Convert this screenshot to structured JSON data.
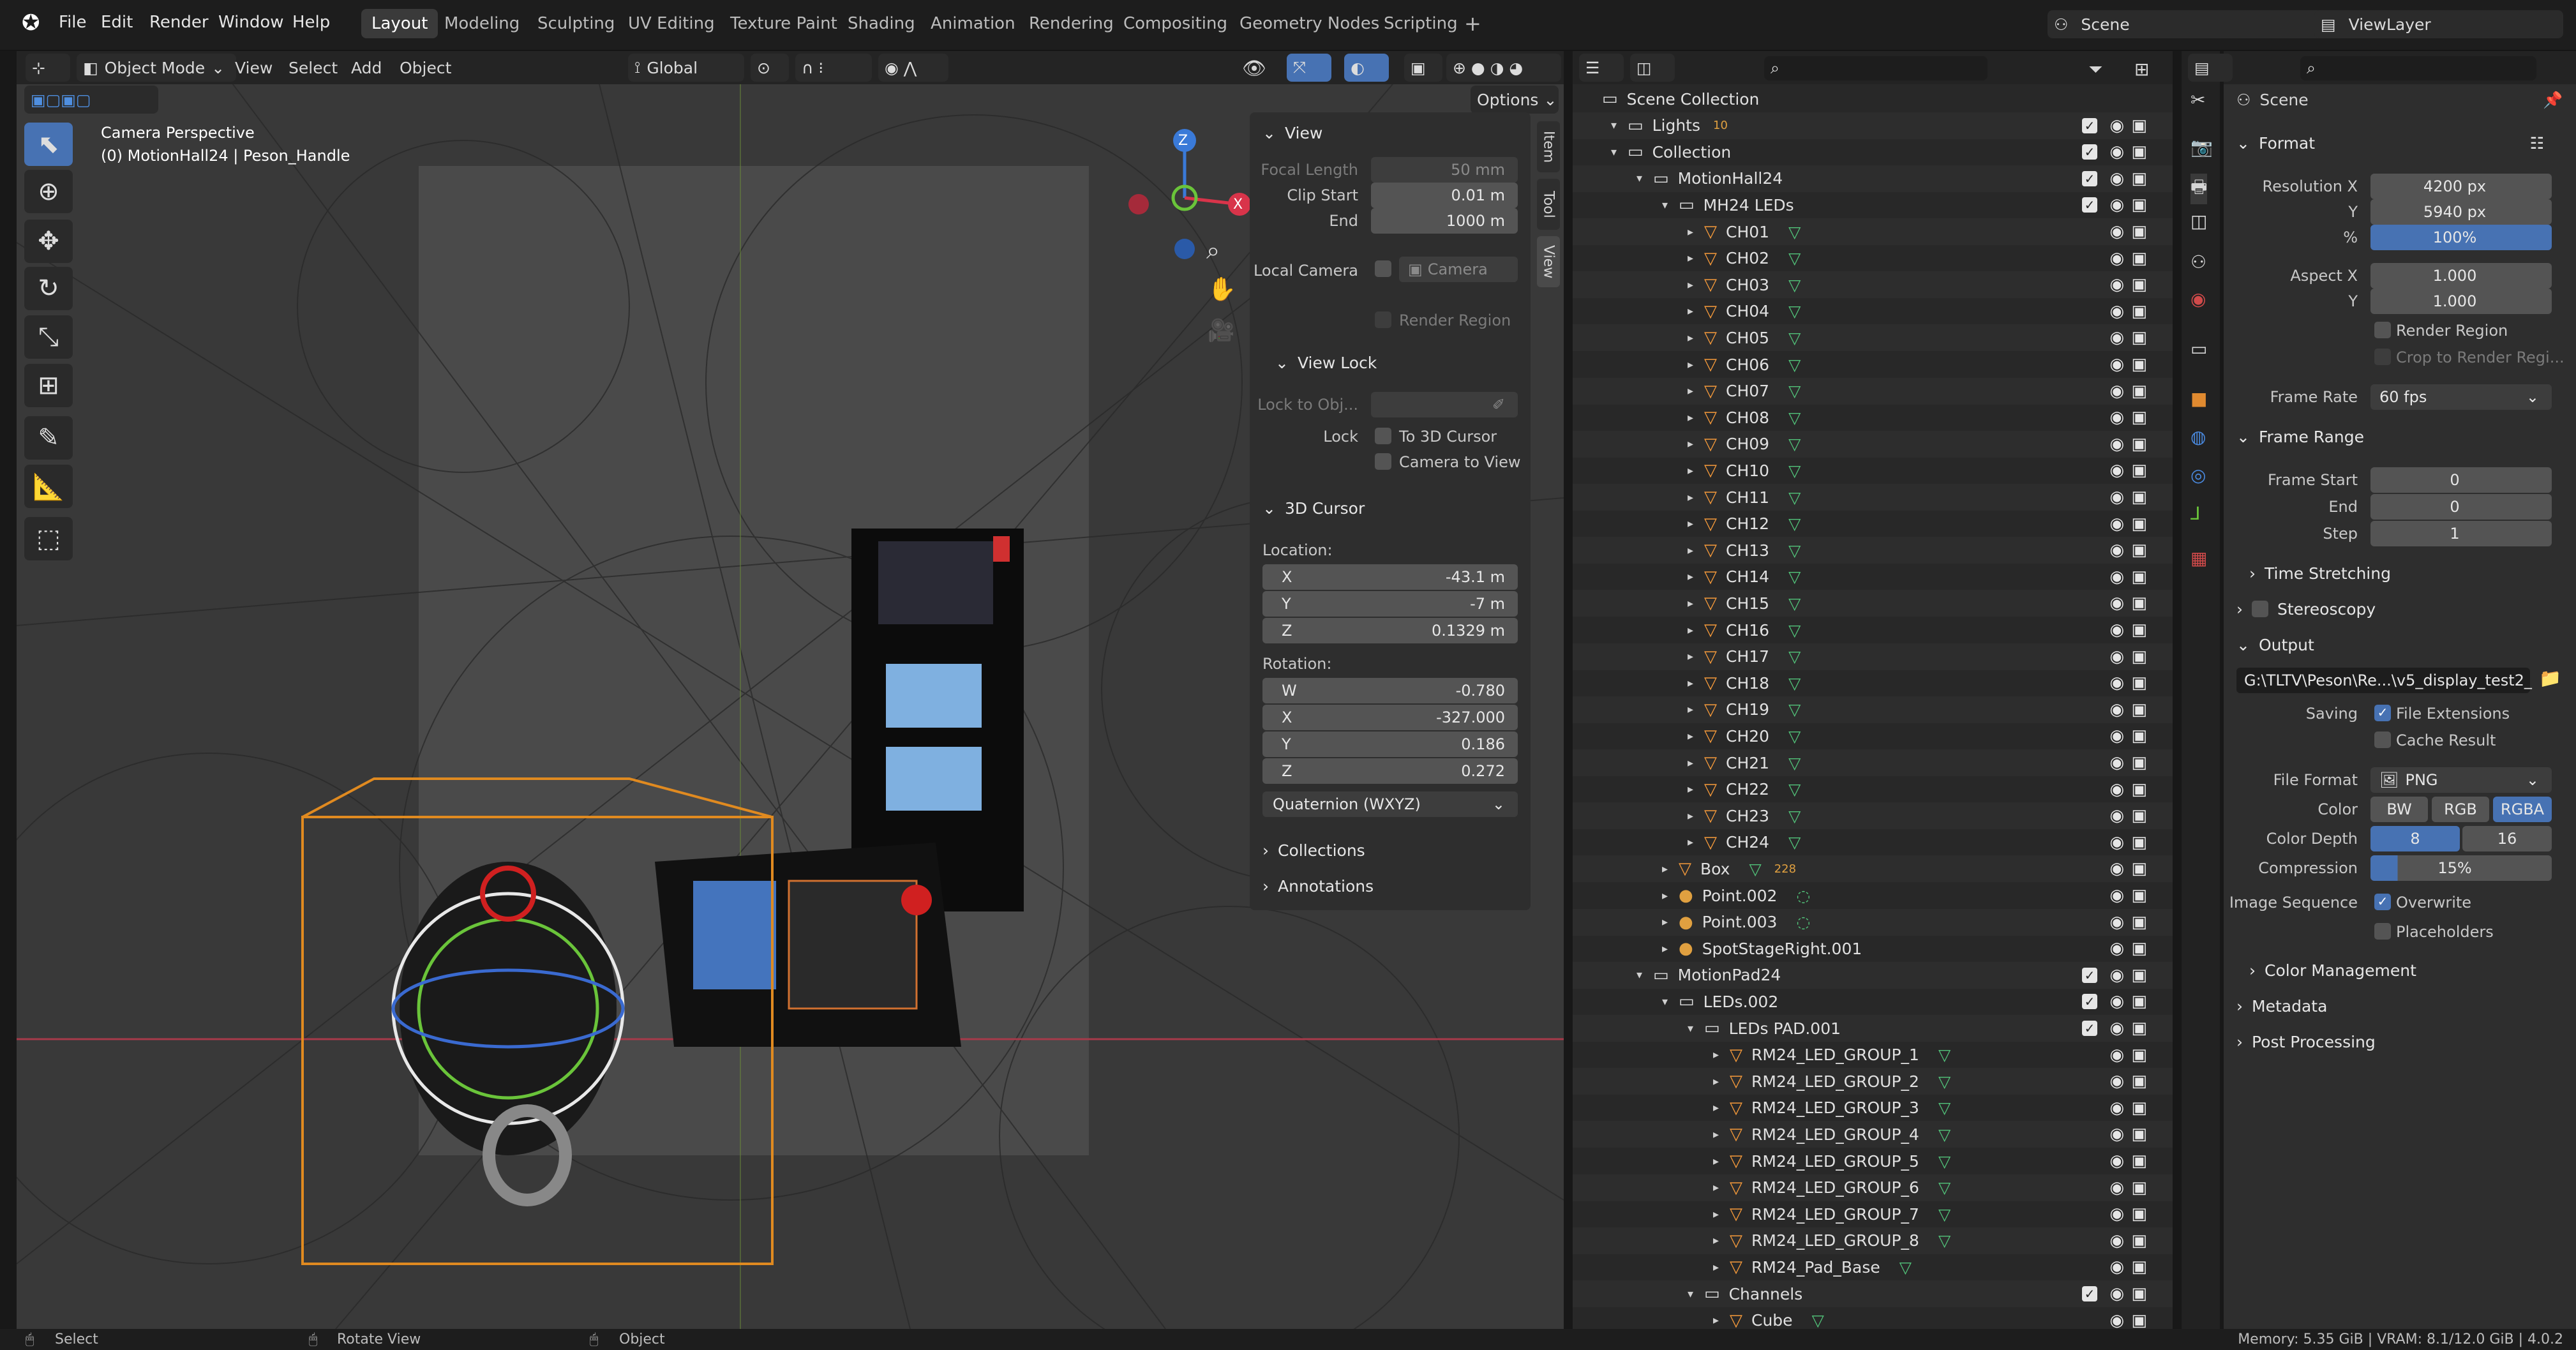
{
  "app": {
    "menus": [
      "File",
      "Edit",
      "Render",
      "Window",
      "Help"
    ],
    "workspaces": [
      "Layout",
      "Modeling",
      "Sculpting",
      "UV Editing",
      "Texture Paint",
      "Shading",
      "Animation",
      "Rendering",
      "Compositing",
      "Geometry Nodes",
      "Scripting"
    ],
    "active_workspace": "Layout",
    "scene": "Scene",
    "view_layer": "ViewLayer"
  },
  "viewport_header": {
    "mode": "Object Mode",
    "menus": [
      "View",
      "Select",
      "Add",
      "Object"
    ],
    "orientation": "Global",
    "options": "Options"
  },
  "viewport": {
    "overlay_title": "Camera Perspective",
    "overlay_subtitle": "(0) MotionHall24 | Peson_Handle",
    "gizmo": {
      "x": "X",
      "y": "Y",
      "z": "Z"
    }
  },
  "npanel": {
    "tabs": [
      "Item",
      "Tool",
      "View"
    ],
    "view_title": "View",
    "focal_length_label": "Focal Length",
    "focal_length": "50 mm",
    "clip_start_label": "Clip Start",
    "clip_start": "0.01 m",
    "end_label": "End",
    "clip_end": "1000 m",
    "local_camera_label": "Local Camera",
    "local_camera_value": "Camera",
    "render_region": "Render Region",
    "view_lock_title": "View Lock",
    "lock_to_obj_label": "Lock to Obj...",
    "lock_label": "Lock",
    "to_3d_cursor": "To 3D Cursor",
    "camera_to_view": "Camera to View",
    "cursor_title": "3D Cursor",
    "location_label": "Location:",
    "loc": [
      {
        "axis": "X",
        "value": "-43.1 m"
      },
      {
        "axis": "Y",
        "value": "-7 m"
      },
      {
        "axis": "Z",
        "value": "0.1329 m"
      }
    ],
    "rotation_label": "Rotation:",
    "rot": [
      {
        "axis": "W",
        "value": "-0.780"
      },
      {
        "axis": "X",
        "value": "-327.000"
      },
      {
        "axis": "Y",
        "value": "0.186"
      },
      {
        "axis": "Z",
        "value": "0.272"
      }
    ],
    "rot_mode": "Quaternion (WXYZ)",
    "collections": "Collections",
    "annotations": "Annotations"
  },
  "outliner": {
    "rows": [
      {
        "label": "Scene Collection",
        "indent": 0,
        "kind": "scene"
      },
      {
        "label": "Lights",
        "indent": 1,
        "kind": "col",
        "extra": "10"
      },
      {
        "label": "Collection",
        "indent": 1,
        "kind": "col"
      },
      {
        "label": "MotionHall24",
        "indent": 2,
        "kind": "col"
      },
      {
        "label": "MH24 LEDs",
        "indent": 3,
        "kind": "col"
      },
      {
        "label": "CH01",
        "indent": 4,
        "kind": "mesh"
      },
      {
        "label": "CH02",
        "indent": 4,
        "kind": "mesh"
      },
      {
        "label": "CH03",
        "indent": 4,
        "kind": "mesh"
      },
      {
        "label": "CH04",
        "indent": 4,
        "kind": "mesh"
      },
      {
        "label": "CH05",
        "indent": 4,
        "kind": "mesh"
      },
      {
        "label": "CH06",
        "indent": 4,
        "kind": "mesh"
      },
      {
        "label": "CH07",
        "indent": 4,
        "kind": "mesh"
      },
      {
        "label": "CH08",
        "indent": 4,
        "kind": "mesh"
      },
      {
        "label": "CH09",
        "indent": 4,
        "kind": "mesh"
      },
      {
        "label": "CH10",
        "indent": 4,
        "kind": "mesh"
      },
      {
        "label": "CH11",
        "indent": 4,
        "kind": "mesh"
      },
      {
        "label": "CH12",
        "indent": 4,
        "kind": "mesh"
      },
      {
        "label": "CH13",
        "indent": 4,
        "kind": "mesh"
      },
      {
        "label": "CH14",
        "indent": 4,
        "kind": "mesh"
      },
      {
        "label": "CH15",
        "indent": 4,
        "kind": "mesh"
      },
      {
        "label": "CH16",
        "indent": 4,
        "kind": "mesh"
      },
      {
        "label": "CH17",
        "indent": 4,
        "kind": "mesh"
      },
      {
        "label": "CH18",
        "indent": 4,
        "kind": "mesh"
      },
      {
        "label": "CH19",
        "indent": 4,
        "kind": "mesh"
      },
      {
        "label": "CH20",
        "indent": 4,
        "kind": "mesh"
      },
      {
        "label": "CH21",
        "indent": 4,
        "kind": "mesh"
      },
      {
        "label": "CH22",
        "indent": 4,
        "kind": "mesh"
      },
      {
        "label": "CH23",
        "indent": 4,
        "kind": "mesh"
      },
      {
        "label": "CH24",
        "indent": 4,
        "kind": "mesh"
      },
      {
        "label": "Box",
        "indent": 3,
        "kind": "mesh",
        "extra": "228"
      },
      {
        "label": "Point.002",
        "indent": 3,
        "kind": "light"
      },
      {
        "label": "Point.003",
        "indent": 3,
        "kind": "light"
      },
      {
        "label": "SpotStageRight.001",
        "indent": 3,
        "kind": "light"
      },
      {
        "label": "MotionPad24",
        "indent": 2,
        "kind": "col"
      },
      {
        "label": "LEDs.002",
        "indent": 3,
        "kind": "col"
      },
      {
        "label": "LEDs PAD.001",
        "indent": 4,
        "kind": "col"
      },
      {
        "label": "RM24_LED_GROUP_1",
        "indent": 5,
        "kind": "mesh"
      },
      {
        "label": "RM24_LED_GROUP_2",
        "indent": 5,
        "kind": "mesh"
      },
      {
        "label": "RM24_LED_GROUP_3",
        "indent": 5,
        "kind": "mesh"
      },
      {
        "label": "RM24_LED_GROUP_4",
        "indent": 5,
        "kind": "mesh"
      },
      {
        "label": "RM24_LED_GROUP_5",
        "indent": 5,
        "kind": "mesh"
      },
      {
        "label": "RM24_LED_GROUP_6",
        "indent": 5,
        "kind": "mesh"
      },
      {
        "label": "RM24_LED_GROUP_7",
        "indent": 5,
        "kind": "mesh"
      },
      {
        "label": "RM24_LED_GROUP_8",
        "indent": 5,
        "kind": "mesh"
      },
      {
        "label": "RM24_Pad_Base",
        "indent": 5,
        "kind": "mesh"
      },
      {
        "label": "Channels",
        "indent": 4,
        "kind": "col"
      },
      {
        "label": "Cube",
        "indent": 5,
        "kind": "mesh"
      }
    ]
  },
  "properties": {
    "context": "Scene",
    "format_title": "Format",
    "res_x_label": "Resolution X",
    "res_x": "4200 px",
    "res_y_label": "Y",
    "res_y": "5940 px",
    "res_pct_label": "%",
    "res_pct": "100%",
    "aspect_x_label": "Aspect X",
    "aspect_x": "1.000",
    "aspect_y_label": "Y",
    "aspect_y": "1.000",
    "render_region": "Render Region",
    "crop_region": "Crop to Render Regi...",
    "frame_rate_label": "Frame Rate",
    "frame_rate": "60 fps",
    "frame_range_title": "Frame Range",
    "frame_start_label": "Frame Start",
    "frame_start": "0",
    "frame_end_label": "End",
    "frame_end": "0",
    "step_label": "Step",
    "step": "1",
    "time_stretching": "Time Stretching",
    "stereoscopy": "Stereoscopy",
    "output_title": "Output",
    "output_path": "G:\\TLTV\\Peson\\Re...\\v5_display_test2_",
    "saving_label": "Saving",
    "file_extensions": "File Extensions",
    "cache_result": "Cache Result",
    "file_format_label": "File Format",
    "file_format": "PNG",
    "color_label": "Color",
    "color_opts": [
      "BW",
      "RGB",
      "RGBA"
    ],
    "color_depth_label": "Color Depth",
    "depth_opts": [
      "8",
      "16"
    ],
    "compression_label": "Compression",
    "compression": "15%",
    "image_seq_label": "Image Sequence",
    "overwrite": "Overwrite",
    "placeholders": "Placeholders",
    "color_management": "Color Management",
    "metadata": "Metadata",
    "post_processing": "Post Processing"
  },
  "status": {
    "select": "Select",
    "rotate": "Rotate View",
    "object": "Object",
    "memory": "Memory: 5.35 GiB | VRAM: 8.1/12.0 GiB | 4.0.2"
  }
}
